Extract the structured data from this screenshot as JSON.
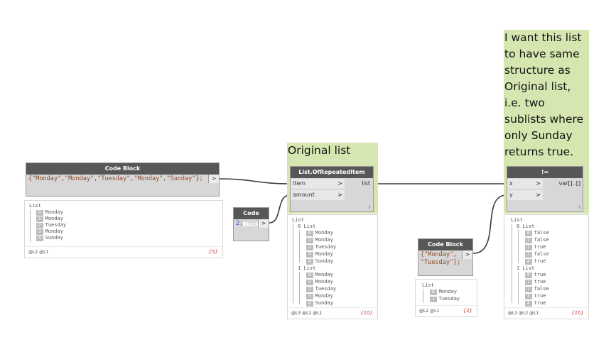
{
  "groups": {
    "original": {
      "title": "Original list"
    },
    "note": {
      "text": "I want this list to have same structure as Original list, i.e. two sublists where only Sunday returns true."
    }
  },
  "nodes": {
    "code_block_days": {
      "title": "Code Block",
      "code": "{\"Monday\",\"Monday\",\"Tuesday\",\"Monday\",\"Sunday\"};",
      "out_port": ">"
    },
    "code_block_two": {
      "title": "Code Block",
      "code": "2;",
      "out_port": ">"
    },
    "repeated_item": {
      "title": "List.OfRepeatedItem",
      "inputs": [
        {
          "label": "item",
          "arrow": ">"
        },
        {
          "label": "amount",
          "arrow": ">"
        }
      ],
      "output": "list",
      "lacing": "l"
    },
    "code_block_small": {
      "title": "Code Block",
      "code_lines": [
        "{\"Monday\",",
        "\"Tuesday\"};"
      ],
      "out_port": ">"
    },
    "not_equal": {
      "title": "!=",
      "inputs": [
        {
          "label": "x",
          "arrow": ">"
        },
        {
          "label": "y",
          "arrow": ">"
        }
      ],
      "output": "var[]..[]",
      "lacing": "l"
    }
  },
  "watches": {
    "days": {
      "header": "List",
      "items": [
        {
          "index": "0",
          "value": "Monday"
        },
        {
          "index": "1",
          "value": "Monday"
        },
        {
          "index": "2",
          "value": "Tuesday"
        },
        {
          "index": "3",
          "value": "Monday"
        },
        {
          "index": "4",
          "value": "Sunday"
        }
      ],
      "levels": "@L2 @L1",
      "count": "{5}"
    },
    "repeated": {
      "header": "List",
      "sublists": [
        {
          "label": "0 List",
          "items": [
            {
              "index": "0",
              "value": "Monday"
            },
            {
              "index": "1",
              "value": "Monday"
            },
            {
              "index": "2",
              "value": "Tuesday"
            },
            {
              "index": "3",
              "value": "Monday"
            },
            {
              "index": "4",
              "value": "Sunday"
            }
          ]
        },
        {
          "label": "1 List",
          "items": [
            {
              "index": "0",
              "value": "Monday"
            },
            {
              "index": "1",
              "value": "Monday"
            },
            {
              "index": "2",
              "value": "Tuesday"
            },
            {
              "index": "3",
              "value": "Monday"
            },
            {
              "index": "4",
              "value": "Sunday"
            }
          ]
        }
      ],
      "levels": "@L3 @L2 @L1",
      "count": "{10}"
    },
    "small": {
      "header": "List",
      "items": [
        {
          "index": "0",
          "value": "Monday"
        },
        {
          "index": "1",
          "value": "Tuesday"
        }
      ],
      "levels": "@L2 @L1",
      "count": "{2}"
    },
    "result": {
      "header": "List",
      "sublists": [
        {
          "label": "0 List",
          "items": [
            {
              "index": "0",
              "value": "false"
            },
            {
              "index": "1",
              "value": "false"
            },
            {
              "index": "2",
              "value": "true"
            },
            {
              "index": "3",
              "value": "false"
            },
            {
              "index": "4",
              "value": "true"
            }
          ]
        },
        {
          "label": "1 List",
          "items": [
            {
              "index": "0",
              "value": "true"
            },
            {
              "index": "1",
              "value": "true"
            },
            {
              "index": "2",
              "value": "false"
            },
            {
              "index": "3",
              "value": "true"
            },
            {
              "index": "4",
              "value": "true"
            }
          ]
        }
      ],
      "levels": "@L3 @L2 @L1",
      "count": "{10}"
    }
  },
  "colors": {
    "group_fill": "#d6e6b0",
    "node_header": "#575757",
    "wire": "#3c3c3c",
    "code_string": "#8b4a2b",
    "code_number": "#2a59c9",
    "count": "#c43c3c"
  }
}
